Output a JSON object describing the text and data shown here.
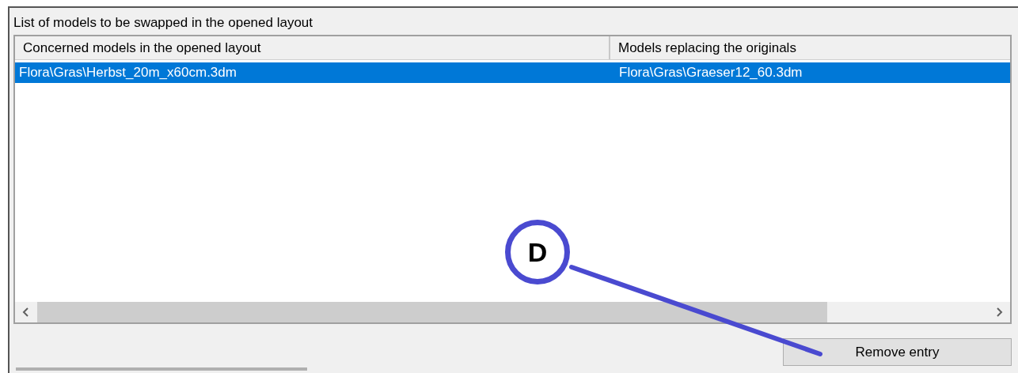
{
  "group": {
    "label": "List of models to be swapped in the opened layout"
  },
  "table": {
    "columns": [
      "Concerned models in the opened layout",
      "Models replacing the originals"
    ],
    "rows": [
      {
        "cells": [
          "Flora\\Gras\\Herbst_20m_x60cm.3dm",
          "Flora\\Gras\\Graeser12_60.3dm"
        ],
        "selected": true
      }
    ]
  },
  "buttons": [
    "Remove entry"
  ],
  "callout": {
    "label": "D"
  }
}
